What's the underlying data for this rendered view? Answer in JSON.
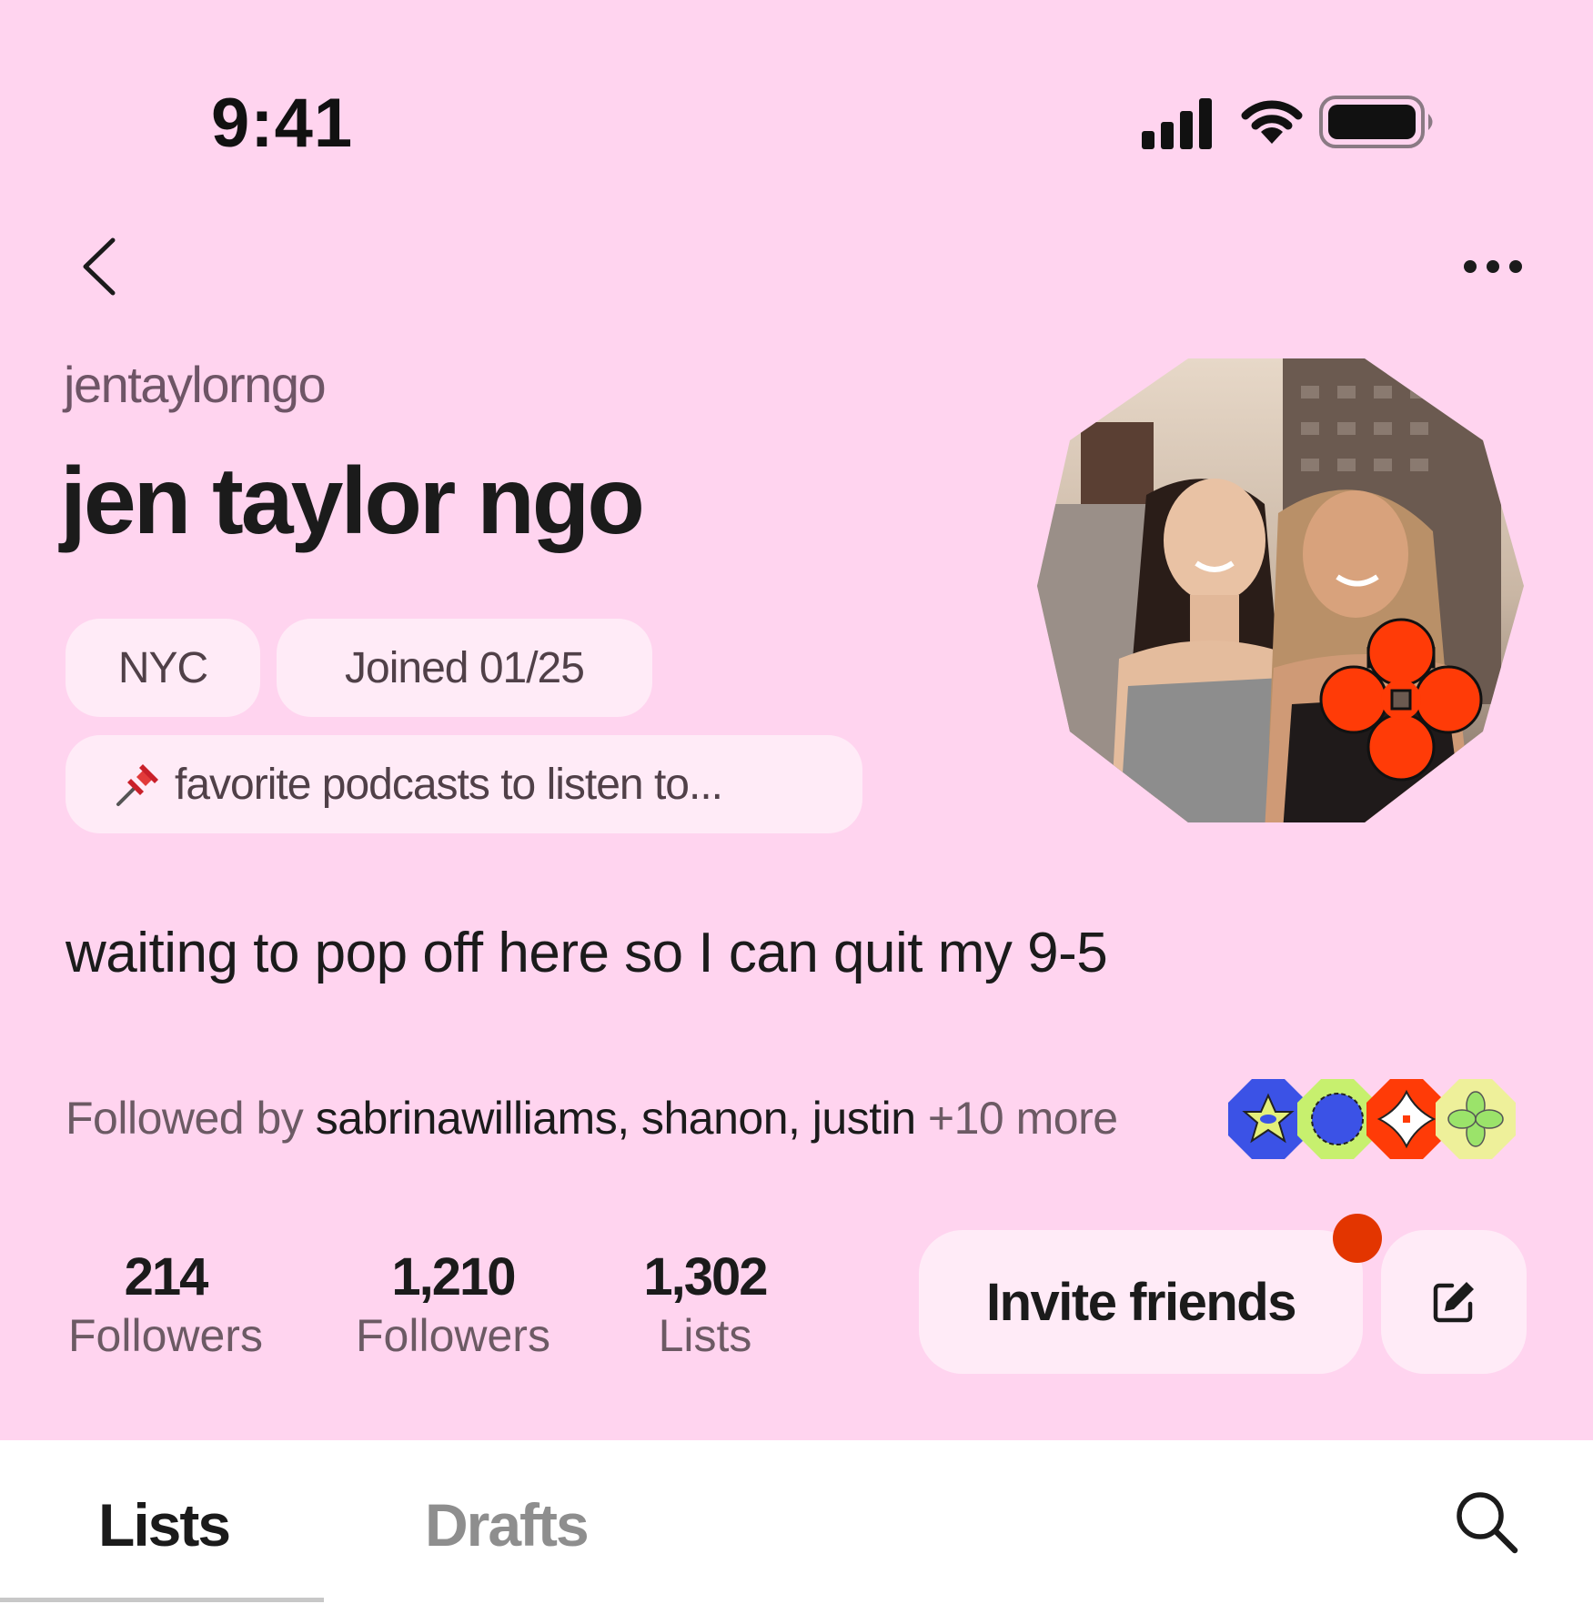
{
  "status_bar": {
    "time": "9:41",
    "icons": [
      "cellular-signal-icon",
      "wifi-icon",
      "battery-icon"
    ]
  },
  "nav": {
    "back_icon": "chevron-left-icon",
    "more_icon": "ellipsis-icon"
  },
  "profile": {
    "username": "jentaylorngo",
    "display_name": "jen taylor ngo",
    "location": "NYC",
    "joined": "Joined 01/25",
    "pinned_icon": "pushpin-icon",
    "pinned_list": "favorite podcasts to listen to...",
    "bio": "waiting to pop off here so I can quit my 9-5"
  },
  "followed_by": {
    "prefix": "Followed by ",
    "names": "sabrinawilliams, shanon, justin",
    "more": " +10 more"
  },
  "stats": [
    {
      "value": "214",
      "label": "Followers"
    },
    {
      "value": "1,210",
      "label": "Followers"
    },
    {
      "value": "1,302",
      "label": "Lists"
    }
  ],
  "actions": {
    "invite_label": "Invite friends",
    "edit_icon": "edit-icon"
  },
  "tabs": [
    {
      "label": "Lists",
      "active": true
    },
    {
      "label": "Drafts",
      "active": false
    }
  ],
  "colors": {
    "header_bg": "#ffd4ef",
    "chip_bg": "#ffebf7",
    "accent_red": "#e33500"
  }
}
